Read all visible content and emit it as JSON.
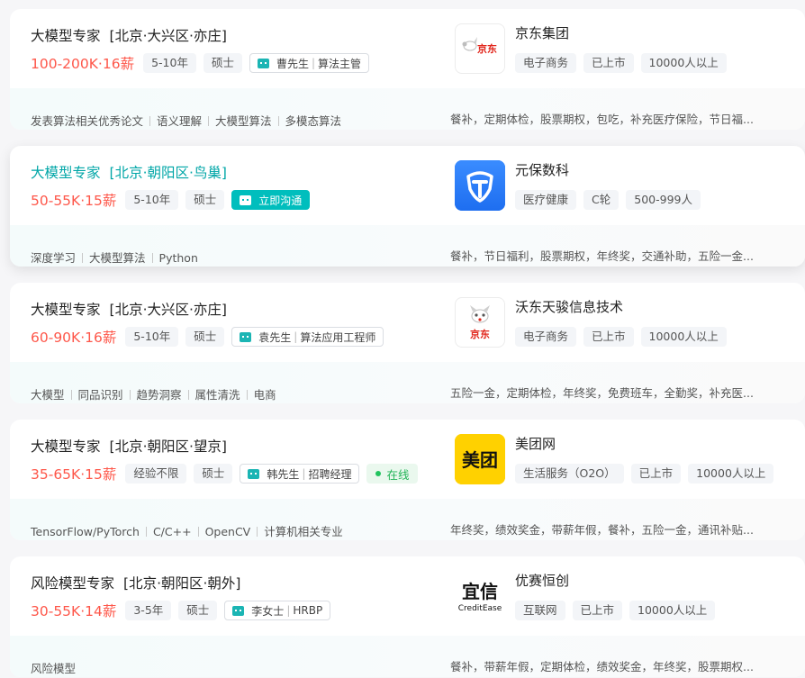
{
  "jobs": [
    {
      "title": "大模型专家",
      "area": "[北京·大兴区·亦庄]",
      "salary": "100-200K·16薪",
      "experience": "5-10年",
      "degree": "硕士",
      "boss_name": "曹先生",
      "boss_title": "算法主管",
      "skills": [
        "发表算法相关优秀论文",
        "语义理解",
        "大模型算法",
        "多模态算法"
      ],
      "company": "京东集团",
      "company_tags": [
        "电子商务",
        "已上市",
        "10000人以上"
      ],
      "welfare": "餐补，定期体检，股票期权，包吃，补充医疗保险，节日福..."
    },
    {
      "title": "大模型专家",
      "area": "[北京·朝阳区·鸟巢]",
      "salary": "50-55K·15薪",
      "experience": "5-10年",
      "degree": "硕士",
      "cta": "立即沟通",
      "skills": [
        "深度学习",
        "大模型算法",
        "Python"
      ],
      "company": "元保数科",
      "company_tags": [
        "医疗健康",
        "C轮",
        "500-999人"
      ],
      "welfare": "餐补，节日福利，股票期权，年终奖，交通补助，五险一金..."
    },
    {
      "title": "大模型专家",
      "area": "[北京·大兴区·亦庄]",
      "salary": "60-90K·16薪",
      "experience": "5-10年",
      "degree": "硕士",
      "boss_name": "袁先生",
      "boss_title": "算法应用工程师",
      "skills": [
        "大模型",
        "同品识别",
        "趋势洞察",
        "属性清洗",
        "电商"
      ],
      "company": "沃东天骏信息技术",
      "company_tags": [
        "电子商务",
        "已上市",
        "10000人以上"
      ],
      "welfare": "五险一金，定期体检，年终奖，免费班车，全勤奖，补充医..."
    },
    {
      "title": "大模型专家",
      "area": "[北京·朝阳区·望京]",
      "salary": "35-65K·15薪",
      "experience": "经验不限",
      "degree": "硕士",
      "boss_name": "韩先生",
      "boss_title": "招聘经理",
      "status": "在线",
      "skills": [
        "TensorFlow/PyTorch",
        "C/C++",
        "OpenCV",
        "计算机相关专业"
      ],
      "company": "美团网",
      "company_tags": [
        "生活服务（O2O）",
        "已上市",
        "10000人以上"
      ],
      "welfare": "年终奖，绩效奖金，带薪年假，餐补，五险一金，通讯补贴..."
    },
    {
      "title": "风险模型专家",
      "area": "[北京·朝阳区·朝外]",
      "salary": "30-55K·14薪",
      "experience": "3-5年",
      "degree": "硕士",
      "boss_name": "李女士",
      "boss_title": "HRBP",
      "skills": [
        "风险模型"
      ],
      "company": "优赛恒创",
      "company_tags": [
        "互联网",
        "已上市",
        "10000人以上"
      ],
      "welfare": "餐补，带薪年假，定期体检，绩效奖金，年终奖，股票期权..."
    }
  ],
  "logos": {
    "jd_group": {
      "text": "京东",
      "icon": "jd-joy-dog-icon",
      "color": "#e1251b"
    },
    "yuanbao": {
      "icon": "shield-t-icon",
      "color": "#2e7cf6"
    },
    "wodong": {
      "text": "京东",
      "icon": "jd-joy-dog-icon",
      "color": "#e1251b"
    },
    "meituan": {
      "text": "美团",
      "color": "#ffd100"
    },
    "creditease": {
      "text_cn": "宜信",
      "text_en": "CreditEase"
    }
  },
  "colors": {
    "salary": "#fe574a",
    "accent": "#00bebd",
    "online": "#22b357"
  }
}
